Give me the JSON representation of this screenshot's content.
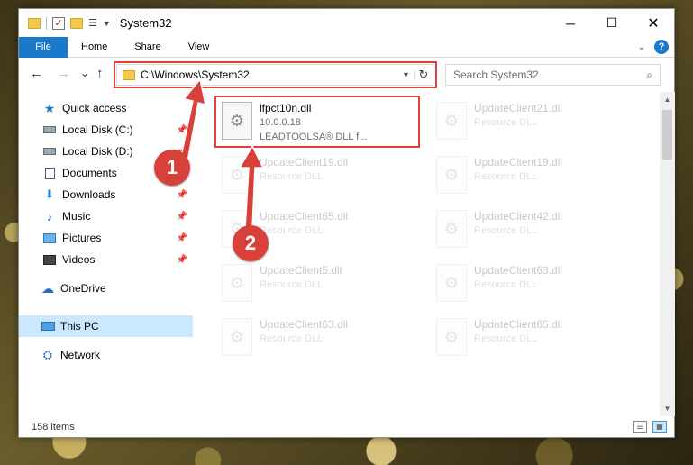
{
  "title_bar": {
    "title": "System32",
    "minimize": "─",
    "maximize": "☐",
    "close": "✕"
  },
  "ribbon": {
    "tabs": [
      "File",
      "Home",
      "Share",
      "View"
    ]
  },
  "nav": {
    "back": "←",
    "forward": "→",
    "recent": "⌄",
    "up": "↑",
    "address": "C:\\Windows\\System32",
    "search_placeholder": "Search System32"
  },
  "sidebar": {
    "items": [
      {
        "label": "Quick access",
        "icon": "star-icon",
        "pinned": false
      },
      {
        "label": "Local Disk (C:)",
        "icon": "drive-icon",
        "pinned": true
      },
      {
        "label": "Local Disk (D:)",
        "icon": "drive-icon",
        "pinned": true
      },
      {
        "label": "Documents",
        "icon": "documents-icon",
        "pinned": true
      },
      {
        "label": "Downloads",
        "icon": "download-icon",
        "pinned": true
      },
      {
        "label": "Music",
        "icon": "music-icon",
        "pinned": true
      },
      {
        "label": "Pictures",
        "icon": "pictures-icon",
        "pinned": true
      },
      {
        "label": "Videos",
        "icon": "videos-icon",
        "pinned": true
      },
      {
        "label": "OneDrive",
        "icon": "onedrive-icon",
        "pinned": false
      },
      {
        "label": "This PC",
        "icon": "pc-icon",
        "pinned": false,
        "selected": true
      },
      {
        "label": "Network",
        "icon": "network-icon",
        "pinned": false
      }
    ]
  },
  "files": [
    {
      "name": "lfpct10n.dll",
      "line2": "10.0.0.18",
      "line3": "LEADTOOLSA® DLL f..."
    },
    {
      "name": "UpdateClient21.dll",
      "line2": "Resource DLL"
    },
    {
      "name": "UpdateClient19.dll",
      "line2": "Resource DLL"
    },
    {
      "name": "UpdateClient19.dll",
      "line2": "Resource DLL"
    },
    {
      "name": "UpdateClient65.dll",
      "line2": "Resource DLL"
    },
    {
      "name": "UpdateClient42.dll",
      "line2": "Resource DLL"
    },
    {
      "name": "UpdateClient5.dll",
      "line2": "Resource DLL"
    },
    {
      "name": "UpdateClient63.dll",
      "line2": "Resource DLL"
    },
    {
      "name": "UpdateClient63.dll",
      "line2": "Resource DLL"
    },
    {
      "name": "UpdateClient65.dll",
      "line2": "Resource DLL"
    }
  ],
  "status": {
    "items_count": "158 items"
  },
  "annotations": {
    "step1": "1",
    "step2": "2",
    "color": "#d8403a"
  }
}
